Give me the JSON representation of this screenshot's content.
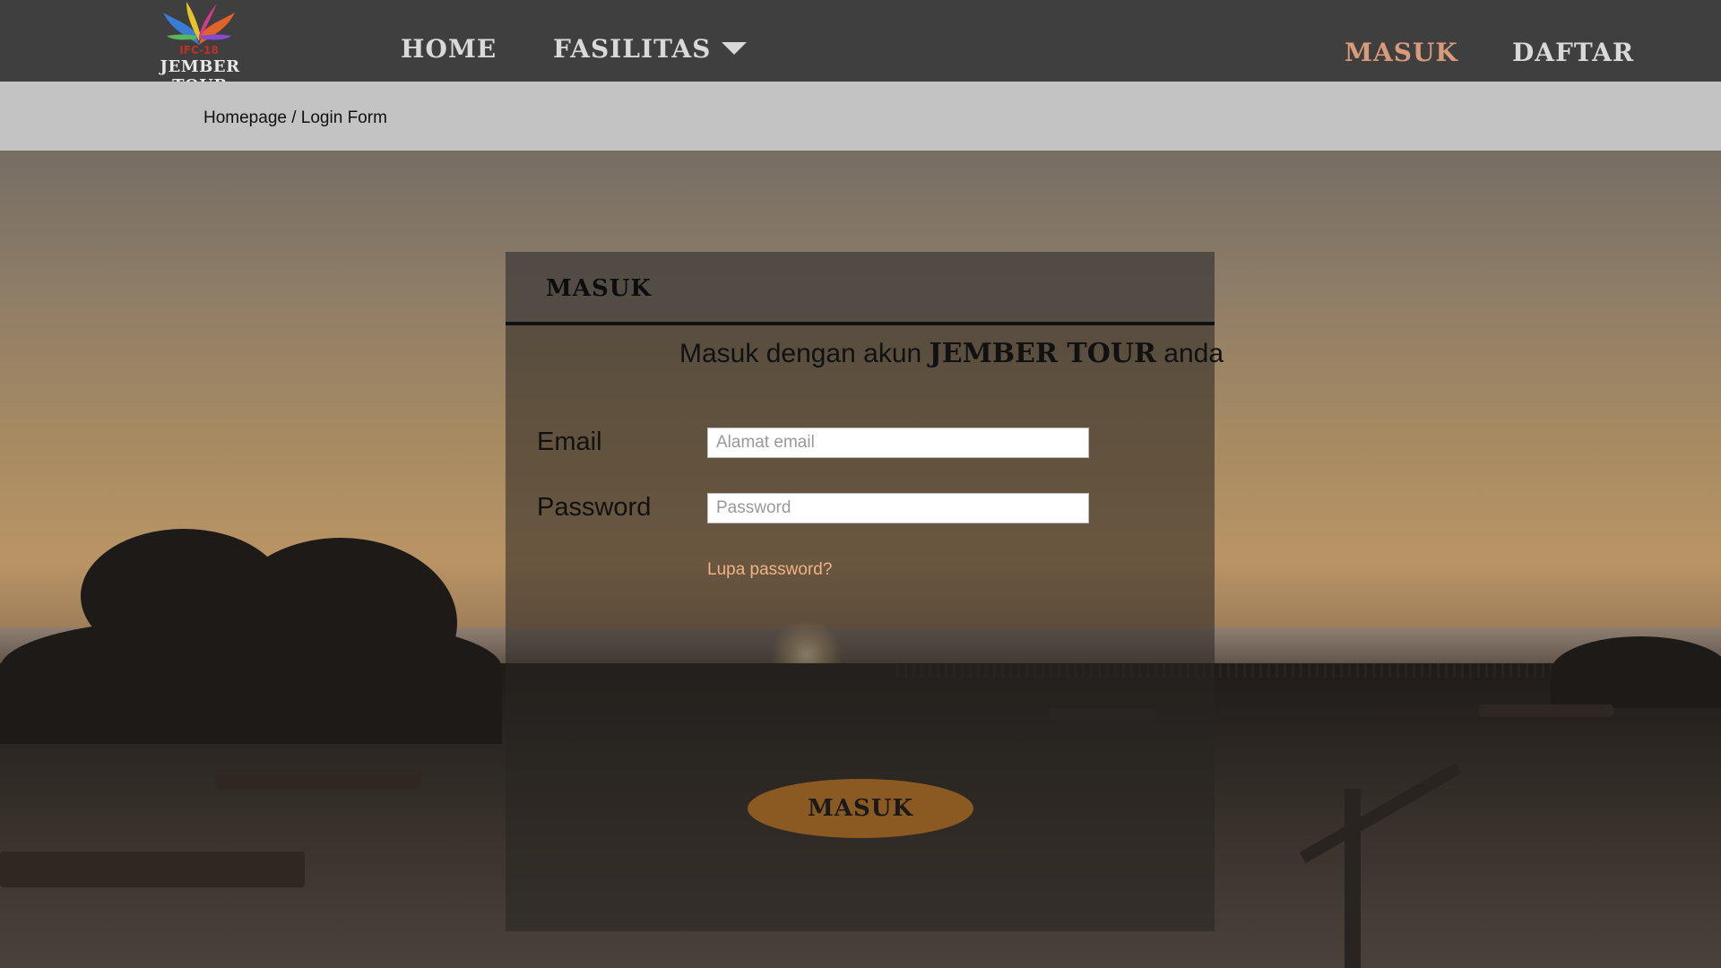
{
  "brand": {
    "logo_text": "JEMBER TOUR",
    "logo_badge": "IFC-18"
  },
  "nav": {
    "home": "HOME",
    "fasilitas": "FASILITAS",
    "masuk": "MASUK",
    "daftar": "DAFTAR",
    "active_color": "#d89a7a"
  },
  "breadcrumb": {
    "home": "Homepage",
    "separator": " / ",
    "current": "Login Form"
  },
  "login": {
    "title": "MASUK",
    "subtitle_prefix": "Masuk dengan akun ",
    "subtitle_brand": "JEMBER TOUR",
    "subtitle_suffix": " anda",
    "email_label": "Email",
    "email_placeholder": "Alamat email",
    "password_label": "Password",
    "password_placeholder": "Password",
    "forgot": "Lupa password?",
    "submit": "MASUK",
    "submit_color": "#8a5a22"
  }
}
